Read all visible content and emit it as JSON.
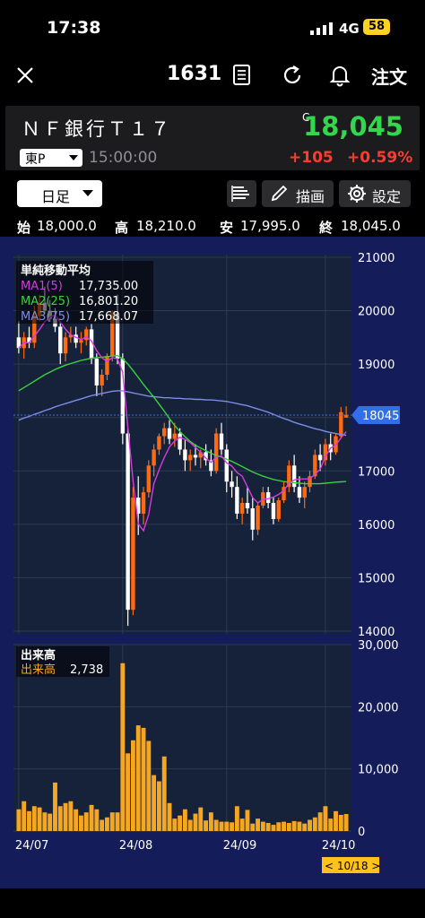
{
  "status_bar": {
    "time": "17:38",
    "network": "4G",
    "battery": "58"
  },
  "header": {
    "code": "1631",
    "order_label": "注文"
  },
  "stock": {
    "name": "ＮＦ銀行Ｔ１７",
    "market": "東P",
    "time": "15:00:00",
    "close_flag": "C",
    "price": "18,045",
    "change": "+105",
    "change_pct": "+0.59%"
  },
  "toolbar": {
    "period": "日足",
    "draw_label": "描画",
    "settings_label": "設定"
  },
  "ohlc": {
    "open_label": "始",
    "open": "18,000.0",
    "high_label": "高",
    "high": "18,210.0",
    "low_label": "安",
    "low": "17,995.0",
    "close_label": "終",
    "close": "18,045.0"
  },
  "legend": {
    "title": "単純移動平均",
    "ma": [
      {
        "label": "MA1(5)",
        "value": "17,735.00",
        "color": "#d63be0"
      },
      {
        "label": "MA2(25)",
        "value": "16,801.20",
        "color": "#39d439"
      },
      {
        "label": "MA3(75)",
        "value": "17,668.07",
        "color": "#7d8de8"
      }
    ]
  },
  "volume_legend": {
    "title": "出来高",
    "label": "出来高",
    "value": "2,738"
  },
  "price_badge": "18045",
  "date_badge": "< 10/18 >",
  "colors": {
    "up": "#ff6a10",
    "down": "#ffffff",
    "volume": "#f5a623",
    "price_up": "#32d74b",
    "change_down": "#ff3b30"
  },
  "chart_data": {
    "type": "candlestick",
    "y_ticks": [
      "21000",
      "20000",
      "19000",
      "18000",
      "17000",
      "16000",
      "15000",
      "14000"
    ],
    "ylim": [
      13950,
      21050
    ],
    "volume_ticks": [
      "30,000",
      "20,000",
      "10,000",
      "0"
    ],
    "volume_ylim": [
      0,
      30000
    ],
    "x_ticks": [
      "24/07",
      "24/08",
      "24/09",
      "24/10"
    ],
    "x_tick_index": [
      0,
      20,
      40,
      59
    ],
    "ohlc": [
      [
        19500,
        19800,
        19200,
        19300
      ],
      [
        19300,
        19600,
        19100,
        19500
      ],
      [
        19500,
        19700,
        19300,
        19400
      ],
      [
        19400,
        20100,
        19300,
        19900
      ],
      [
        19900,
        20300,
        19800,
        20150
      ],
      [
        20150,
        20450,
        19950,
        20000
      ],
      [
        20000,
        20200,
        19800,
        19850
      ],
      [
        19850,
        20050,
        19600,
        19700
      ],
      [
        19700,
        19800,
        19000,
        19200
      ],
      [
        19200,
        19600,
        19050,
        19500
      ],
      [
        19500,
        19700,
        19400,
        19550
      ],
      [
        19550,
        19700,
        19300,
        19400
      ],
      [
        19400,
        19600,
        19200,
        19450
      ],
      [
        19450,
        19700,
        19350,
        19650
      ],
      [
        19650,
        19750,
        19000,
        19100
      ],
      [
        19100,
        19200,
        18400,
        18600
      ],
      [
        18600,
        18900,
        18400,
        18800
      ],
      [
        18800,
        19200,
        18700,
        19150
      ],
      [
        19150,
        20000,
        19050,
        19950
      ],
      [
        19950,
        20300,
        19000,
        19100
      ],
      [
        19100,
        19200,
        17500,
        17700
      ],
      [
        17700,
        17800,
        14100,
        14400
      ],
      [
        14400,
        16700,
        14300,
        16500
      ],
      [
        16500,
        16900,
        15800,
        16200
      ],
      [
        16200,
        16700,
        16000,
        16600
      ],
      [
        16600,
        17200,
        16500,
        17100
      ],
      [
        17100,
        17500,
        16900,
        17400
      ],
      [
        17400,
        17700,
        17300,
        17650
      ],
      [
        17650,
        17900,
        17500,
        17800
      ],
      [
        17800,
        17950,
        17500,
        17600
      ],
      [
        17600,
        17900,
        17450,
        17700
      ],
      [
        17700,
        17800,
        17300,
        17400
      ],
      [
        17400,
        17600,
        17000,
        17200
      ],
      [
        17200,
        17400,
        17000,
        17300
      ],
      [
        17300,
        17500,
        17100,
        17250
      ],
      [
        17250,
        17400,
        17050,
        17350
      ],
      [
        17350,
        17500,
        17100,
        17200
      ],
      [
        17200,
        17400,
        16900,
        17000
      ],
      [
        17000,
        17800,
        16950,
        17700
      ],
      [
        17700,
        17900,
        17300,
        17400
      ],
      [
        17400,
        17500,
        16600,
        16800
      ],
      [
        16800,
        17000,
        16500,
        16700
      ],
      [
        16700,
        16900,
        16100,
        16200
      ],
      [
        16200,
        16500,
        16000,
        16400
      ],
      [
        16400,
        16700,
        16200,
        16300
      ],
      [
        16300,
        16500,
        15700,
        15900
      ],
      [
        15900,
        16400,
        15800,
        16350
      ],
      [
        16350,
        16700,
        16300,
        16600
      ],
      [
        16600,
        16700,
        16300,
        16400
      ],
      [
        16400,
        16500,
        16000,
        16100
      ],
      [
        16100,
        16500,
        16050,
        16450
      ],
      [
        16450,
        16800,
        16400,
        16700
      ],
      [
        16700,
        17200,
        16600,
        17100
      ],
      [
        17100,
        17300,
        16600,
        16700
      ],
      [
        16700,
        16900,
        16400,
        16500
      ],
      [
        16500,
        16800,
        16300,
        16700
      ],
      [
        16700,
        17000,
        16600,
        16900
      ],
      [
        16900,
        17400,
        16850,
        17300
      ],
      [
        17300,
        17500,
        17000,
        17200
      ],
      [
        17200,
        17600,
        17100,
        17500
      ],
      [
        17500,
        17700,
        17200,
        17350
      ],
      [
        17350,
        17700,
        17300,
        17650
      ],
      [
        17650,
        18200,
        17600,
        18100
      ],
      [
        18000,
        18210,
        17995,
        18045
      ]
    ],
    "ma1": [
      19300,
      19400,
      19400,
      19525,
      19650,
      19790,
      19880,
      19920,
      19790,
      19650,
      19550,
      19500,
      19460,
      19510,
      19430,
      19250,
      19120,
      19050,
      19120,
      19100,
      18850,
      17820,
      16810,
      16010,
      15880,
      16180,
      16760,
      17020,
      17250,
      17450,
      17560,
      17630,
      17590,
      17530,
      17440,
      17350,
      17240,
      17160,
      17260,
      17280,
      17150,
      17090,
      16970,
      16900,
      16700,
      16500,
      16400,
      16470,
      16480,
      16510,
      16560,
      16630,
      16770,
      16830,
      16850,
      16850,
      16850,
      16940,
      17030,
      17270,
      17430,
      17480,
      17620,
      17735
    ],
    "ma2": [
      18500,
      18560,
      18620,
      18680,
      18740,
      18800,
      18850,
      18900,
      18940,
      18980,
      19010,
      19040,
      19070,
      19090,
      19110,
      19120,
      19130,
      19140,
      19150,
      19160,
      19100,
      19000,
      18880,
      18750,
      18620,
      18500,
      18380,
      18250,
      18120,
      17980,
      17850,
      17740,
      17640,
      17550,
      17480,
      17430,
      17380,
      17330,
      17290,
      17260,
      17220,
      17180,
      17130,
      17080,
      17030,
      16980,
      16940,
      16900,
      16870,
      16840,
      16820,
      16800,
      16790,
      16780,
      16770,
      16760,
      16760,
      16760,
      16760,
      16770,
      16780,
      16790,
      16795,
      16801
    ],
    "ma3": [
      17950,
      17990,
      18020,
      18060,
      18090,
      18130,
      18160,
      18200,
      18230,
      18260,
      18290,
      18320,
      18350,
      18380,
      18410,
      18430,
      18450,
      18470,
      18490,
      18500,
      18500,
      18480,
      18460,
      18440,
      18420,
      18400,
      18390,
      18380,
      18370,
      18370,
      18360,
      18360,
      18350,
      18350,
      18340,
      18340,
      18330,
      18330,
      18320,
      18310,
      18300,
      18280,
      18260,
      18240,
      18220,
      18190,
      18160,
      18130,
      18100,
      18060,
      18020,
      17980,
      17950,
      17910,
      17880,
      17850,
      17820,
      17790,
      17770,
      17740,
      17720,
      17700,
      17680,
      17668
    ],
    "volume": [
      3500,
      4800,
      3200,
      4000,
      3800,
      3000,
      2800,
      7800,
      4000,
      4500,
      4800,
      3500,
      2500,
      3000,
      4200,
      3500,
      1800,
      2200,
      3000,
      3000,
      27000,
      12500,
      14600,
      17000,
      16600,
      14500,
      9000,
      8000,
      12000,
      4500,
      2000,
      2500,
      3500,
      1800,
      2800,
      3800,
      1700,
      3000,
      1800,
      1500,
      1500,
      1400,
      4000,
      2000,
      3400,
      1200,
      2000,
      1500,
      1300,
      1000,
      1400,
      1500,
      1300,
      1600,
      1500,
      1200,
      1800,
      2200,
      3000,
      4000,
      2000,
      3200,
      2600,
      2738
    ]
  }
}
